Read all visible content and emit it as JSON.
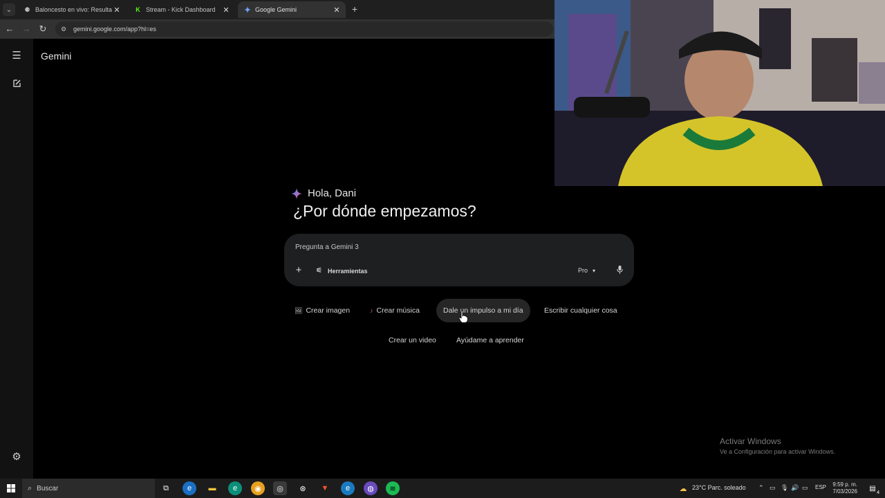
{
  "browser": {
    "tabs": [
      {
        "title": "Baloncesto en vivo: Resultados",
        "favicon": "basketball-icon"
      },
      {
        "title": "Stream - Kick Dashboard",
        "favicon": "kick-icon"
      },
      {
        "title": "Google Gemini",
        "favicon": "gemini-icon",
        "active": true
      }
    ],
    "url": "gemini.google.com/app?hl=es"
  },
  "app": {
    "brand": "Gemini",
    "greeting": "Hola, Dani",
    "heading": "¿Por dónde empezamos?",
    "prompt_placeholder": "Pregunta a Gemini 3",
    "tools_label": "Herramientas",
    "model_label": "Pro",
    "chips": [
      {
        "label": "Crear imagen",
        "icon": "image-emoji-icon"
      },
      {
        "label": "Crear música",
        "icon": "music-emoji-icon"
      },
      {
        "label": "Dale un impulso a mi día",
        "hover": true
      },
      {
        "label": "Escribir cualquier cosa"
      },
      {
        "label": "Crear un video"
      },
      {
        "label": "Ayúdame a aprender"
      }
    ]
  },
  "watermark": {
    "title": "Activar Windows",
    "subtitle": "Ve a Configuración para activar Windows."
  },
  "taskbar": {
    "search_label": "Buscar",
    "weather": "23°C Parc. soleado",
    "language": "ESP",
    "time": "9:59 p. m.",
    "date": "7/03/2026",
    "notification_count": "4"
  },
  "colors": {
    "accent_blue": "#4f8df7",
    "gemini_gradient": [
      "#4285f4",
      "#9b72cb",
      "#d96570"
    ],
    "kick_green": "#53fc18",
    "brave_orange": "#fb542b",
    "spotify_green": "#1db954"
  }
}
